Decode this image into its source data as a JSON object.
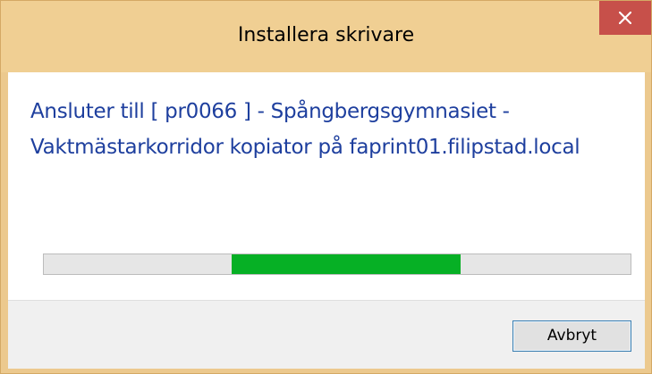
{
  "window": {
    "title": "Installera skrivare",
    "close_icon": "close-icon"
  },
  "dialog": {
    "message": "Ansluter till [ pr0066 ] - Spångbergsgymnasiet - Vaktmästarkorridor kopiator på faprint01.filipstad.local",
    "progress_style": "marquee"
  },
  "buttons": {
    "cancel_label": "Avbryt"
  },
  "colors": {
    "titlebar": "#f0cf93",
    "close_button": "#c7504a",
    "message_text": "#1e3f9e",
    "progress_fill": "#06b025"
  }
}
